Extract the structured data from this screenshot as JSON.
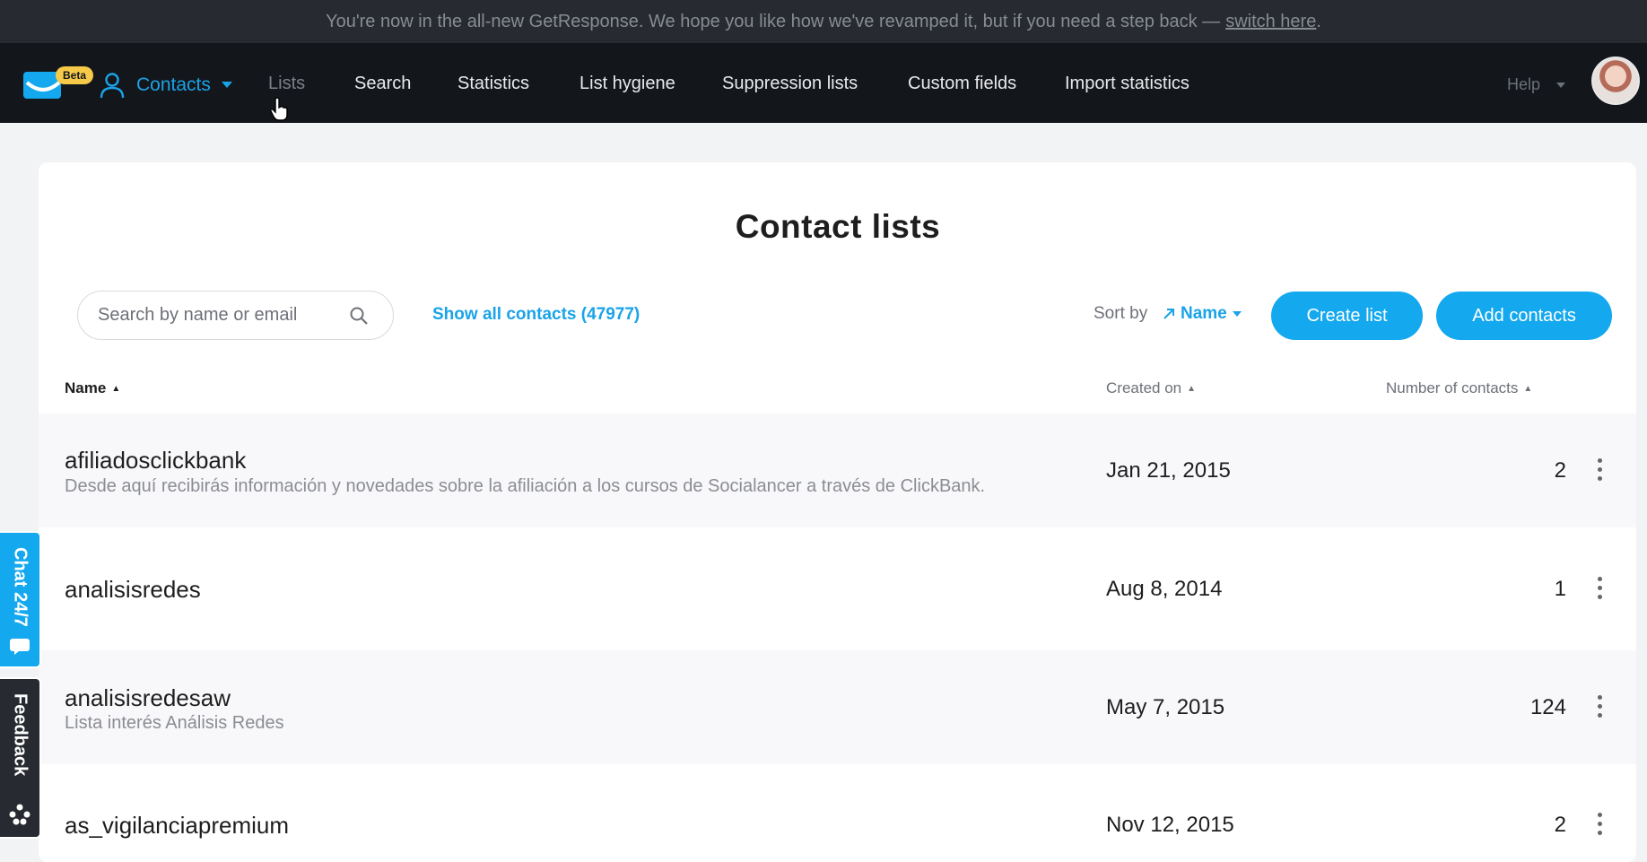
{
  "banner": {
    "message": "You're now in the all-new GetResponse. We hope you like how we've revamped it, but if you need a step back —",
    "link_text": "switch here",
    "end": "."
  },
  "nav": {
    "beta_badge": "Beta",
    "contacts_label": "Contacts",
    "items": [
      "Lists",
      "Search",
      "Statistics",
      "List hygiene",
      "Suppression lists",
      "Custom fields",
      "Import statistics"
    ],
    "help_label": "Help"
  },
  "page": {
    "title": "Contact lists",
    "search_placeholder": "Search by name or email",
    "show_all": "Show all contacts (47977)",
    "sort_label": "Sort by",
    "sort_value": "Name",
    "create_button": "Create list",
    "add_button": "Add contacts"
  },
  "table": {
    "headers": {
      "name": "Name",
      "created": "Created on",
      "count": "Number of contacts"
    },
    "rows": [
      {
        "name": "afiliadosclickbank",
        "description": "Desde aquí recibirás información y novedades sobre la afiliación a los cursos de Socialancer a través de ClickBank.",
        "created": "Jan 21, 2015",
        "count": "2"
      },
      {
        "name": "analisisredes",
        "description": "",
        "created": "Aug 8, 2014",
        "count": "1"
      },
      {
        "name": "analisisredesaw",
        "description": "Lista interés Análisis Redes",
        "created": "May 7, 2015",
        "count": "124"
      },
      {
        "name": "as_vigilanciapremium",
        "description": "",
        "created": "Nov 12, 2015",
        "count": "2"
      }
    ]
  },
  "side_tabs": {
    "chat": "Chat 24/7",
    "feedback": "Feedback"
  },
  "colors": {
    "accent": "#14a8ee",
    "nav_bg": "#13161b",
    "banner_bg": "#272a30"
  },
  "icons": [
    "getresponse-logo-icon",
    "user-icon",
    "chevron-down-icon",
    "search-icon",
    "sort-arrow-icon",
    "kebab-menu-icon",
    "chat-bubble-icon",
    "feedback-dots-icon",
    "hand-cursor-icon"
  ]
}
